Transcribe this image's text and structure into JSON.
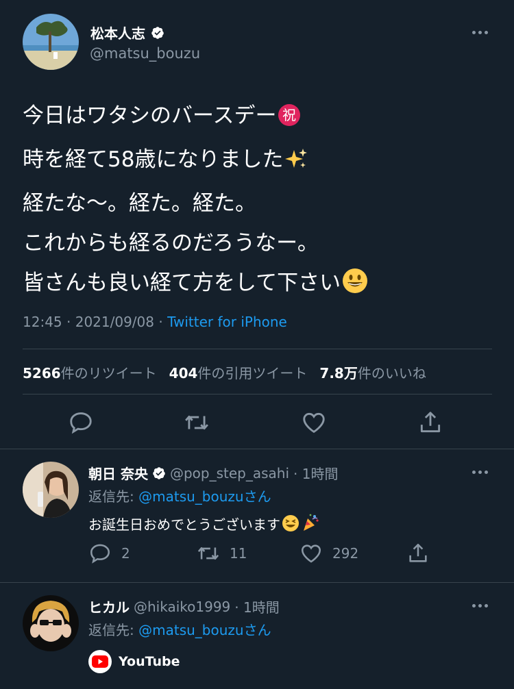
{
  "tweet": {
    "display_name": "松本人志",
    "handle": "@matsu_bouzu",
    "lines": [
      "今日はワタシのバースデー",
      "時を経て58歳になりました",
      "経たな〜。経た。経た。",
      "これからも経るのだろうなー。",
      "皆さんも良い経て方をして下さい"
    ],
    "emoji_names": [
      "congratulations-emoji",
      "sparkles-emoji",
      "smiley-emoji"
    ],
    "time": "12:45",
    "date": "2021/09/08",
    "separator": " · ",
    "source": "Twitter for iPhone",
    "stats": {
      "retweets_count": "5266",
      "retweets_label": "件のリツイート",
      "quotes_count": "404",
      "quotes_label": "件の引用ツイート",
      "likes_count": "7.8万",
      "likes_label": "件のいいね"
    }
  },
  "replies": [
    {
      "display_name": "朝日 奈央",
      "verified": true,
      "handle": "@pop_step_asahi",
      "time": "· 1時間",
      "reply_prefix": "返信先: ",
      "reply_mention": "@matsu_bouzuさん",
      "text": "お誕生日おめでとうございます",
      "emoji_names": [
        "grinning-squinting-emoji",
        "party-popper-emoji"
      ],
      "reply_count": "2",
      "retweet_count": "11",
      "like_count": "292"
    },
    {
      "display_name": "ヒカル",
      "verified": false,
      "handle": "@hikaiko1999",
      "time": "· 1時間",
      "reply_prefix": "返信先: ",
      "reply_mention": "@matsu_bouzuさん",
      "link_label": "YouTube"
    }
  ],
  "colors": {
    "background": "#15202b",
    "text": "#ffffff",
    "secondary": "#8b98a5",
    "accent": "#1d9bf0",
    "divider": "#38444d"
  }
}
